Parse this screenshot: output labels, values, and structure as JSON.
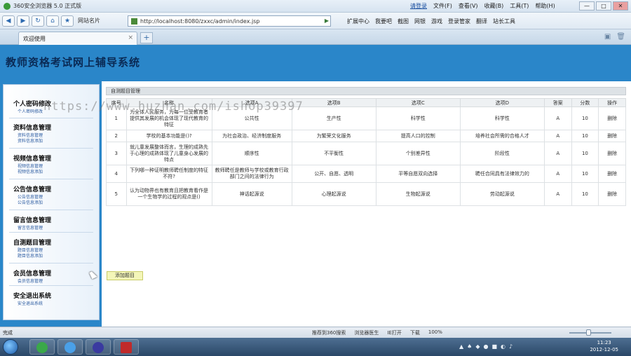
{
  "browser": {
    "title": "360安全浏览器 5.0 正式版",
    "menus": [
      "文件(F)",
      "查看(V)",
      "收藏(B)",
      "工具(T)",
      "帮助(H)"
    ],
    "login": "请登录",
    "window_controls": [
      "—",
      "□",
      "✕"
    ],
    "fav_label": "网站名片",
    "url": "http://localhost:8080/zxxc/admin/index.jsp",
    "tools": [
      "扩展中心",
      "我要吧",
      "截图",
      "网银",
      "游戏",
      "登录管家",
      "翻译",
      "站长工具"
    ],
    "tab_label": "欢迎使用",
    "status": "完成",
    "status_items": [
      "推荐到360搜索",
      "浏览器医生",
      "IE打开",
      "下载",
      "100%"
    ],
    "taskbar_time": "11:23",
    "taskbar_date": "2012-12-05"
  },
  "site": {
    "title": "教师资格考试网上辅导系统"
  },
  "sidebar": {
    "groups": [
      {
        "title": "个人密码修改",
        "subs": [
          "个人密码修改"
        ]
      },
      {
        "title": "资料信息管理",
        "subs": [
          "资料信息管理",
          "资料信息添加"
        ]
      },
      {
        "title": "视频信息管理",
        "subs": [
          "视频信息管理",
          "视频信息添加"
        ]
      },
      {
        "title": "公告信息管理",
        "subs": [
          "公告信息管理",
          "公告信息添加"
        ]
      },
      {
        "title": "留言信息管理",
        "subs": [
          "留言信息管理"
        ]
      },
      {
        "title": "自测题目管理",
        "subs": [
          "题目信息管理",
          "题目信息添加"
        ]
      },
      {
        "title": "会员信息管理",
        "subs": [
          "会员信息管理"
        ]
      },
      {
        "title": "安全退出系统",
        "subs": [
          "安全退出系统"
        ]
      }
    ]
  },
  "panel": {
    "title": "自测题目管理",
    "columns": [
      "序号",
      "名称",
      "选项A",
      "选项B",
      "选项C",
      "选项D",
      "答案",
      "分数",
      "操作"
    ],
    "rows": [
      {
        "no": "1",
        "name": "为全体人民服务，为每一位受教育者提供其发展的机会体现了现代教育的特征",
        "a": "公共性",
        "b": "生产性",
        "c": "科学性",
        "d": "科学性",
        "ans": "A",
        "score": "10",
        "op": "删除"
      },
      {
        "no": "2",
        "name": "学校的基本功能是()?",
        "a": "为社会政治、经济制度服务",
        "b": "为繁荣文化服务",
        "c": "提高人口的控制",
        "d": "培养社会所需的合格人才",
        "ans": "A",
        "score": "10",
        "op": "删除"
      },
      {
        "no": "3",
        "name": "就儿童发展整体而言，生理的成熟先于心理的成熟体现了儿童身心发展的特点",
        "a": "顺序性",
        "b": "不平衡性",
        "c": "个别差异性",
        "d": "阶段性",
        "ans": "A",
        "score": "10",
        "op": "删除"
      },
      {
        "no": "4",
        "name": "下列哪一种证明教师聘任制度的特征不符?",
        "a": "教师聘任是教师与学校或教育行政部门之间的法律行为",
        "b": "公开、自愿、透明",
        "c": "平等自愿双向选择",
        "d": "聘任合同具有法律效力的",
        "ans": "A",
        "score": "10",
        "op": "删除"
      },
      {
        "no": "5",
        "name": "认为动物界也有教育且把教育看作是一个生物学的过程的观点是()",
        "a": "神话起源说",
        "b": "心理起源说",
        "c": "生物起源说",
        "d": "劳动起源说",
        "ans": "A",
        "score": "10",
        "op": "删除"
      }
    ],
    "add_label": "添加题目"
  },
  "watermark": "https://www.huzhan.com/ishop39397"
}
